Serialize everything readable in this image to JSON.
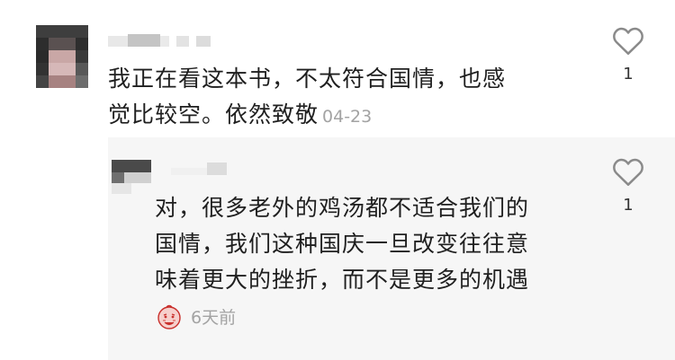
{
  "comment": {
    "text": "我正在看这本书，不太符合国情，也感\n觉比较空。依然致敬",
    "date": "04-23",
    "like_icon": "heart-outline-icon",
    "like_count": "1"
  },
  "reply": {
    "text": "对，很多老外的鸡汤都不适合我们的\n国情，我们这种国庆一旦改变往往意\n味着更大的挫折，而不是更多的机遇",
    "time": "6天前",
    "badge_icon": "cartoon-face-emoji-icon",
    "like_icon": "heart-outline-icon",
    "like_count": "1"
  },
  "colors": {
    "reply_background": "#f6f6f6",
    "meta_text": "#a3a3a3",
    "icon_stroke": "#8a8a8a"
  }
}
